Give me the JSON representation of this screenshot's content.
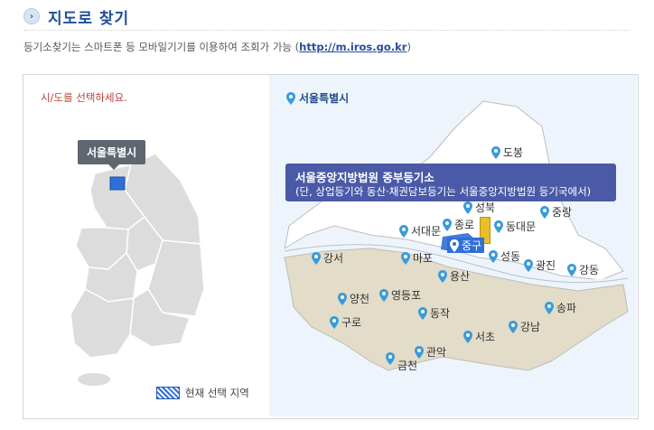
{
  "header": {
    "title": "지도로 찾기"
  },
  "notice": {
    "text": "등기소찾기는 스마트폰 등 모바일기기를 이용하여 조회가 가능 (",
    "link": "http://m.iros.go.kr",
    "suffix": ")"
  },
  "left_pane": {
    "prompt": "시/도를 선택하세요.",
    "selected_province": "서울특별시",
    "legend_label": "현재 선택 지역"
  },
  "right_pane": {
    "region_title": "서울특별시",
    "court_tooltip": {
      "name": "서울중앙지방법원 중부등기소",
      "note": "(단, 상업등기와 동산·채권담보등기는 서울중앙지방법원 등기국에서)"
    },
    "districts": [
      {
        "name": "도봉"
      },
      {
        "name": "중랑"
      },
      {
        "name": "종로"
      },
      {
        "name": "서대문"
      },
      {
        "name": "동대문"
      },
      {
        "name": "중구"
      },
      {
        "name": "마포"
      },
      {
        "name": "성동"
      },
      {
        "name": "광진"
      },
      {
        "name": "강동"
      },
      {
        "name": "강서"
      },
      {
        "name": "용산"
      },
      {
        "name": "양천"
      },
      {
        "name": "영등포"
      },
      {
        "name": "송파"
      },
      {
        "name": "구로"
      },
      {
        "name": "동작"
      },
      {
        "name": "서초"
      },
      {
        "name": "강남"
      },
      {
        "name": "금천"
      },
      {
        "name": "관악"
      },
      {
        "name": "성북"
      }
    ]
  },
  "colors": {
    "accent": "#1f4f96",
    "current_region": "#2f6fd6",
    "tooltip_bg": "#4a5aa6",
    "district_fill": "#ffffff",
    "gangnam_fill": "#e2dcc8"
  }
}
